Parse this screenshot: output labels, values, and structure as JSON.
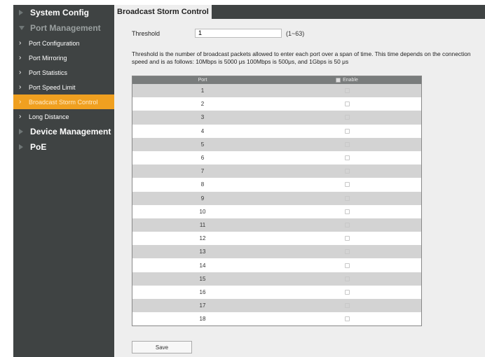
{
  "sidebar": {
    "system_config": "System Config",
    "port_management": "Port Management",
    "items": [
      {
        "label": "Port Configuration"
      },
      {
        "label": "Port Mirroring"
      },
      {
        "label": "Port Statistics"
      },
      {
        "label": "Port Speed Limit"
      },
      {
        "label": "Broadcast Storm Control"
      },
      {
        "label": "Long Distance"
      }
    ],
    "device_management": "Device Management",
    "poe": "PoE"
  },
  "tab": {
    "title": "Broadcast Storm Control"
  },
  "threshold": {
    "label": "Threshold",
    "value": "1",
    "range": "(1~63)"
  },
  "description": "Threshold is the number of broadcast packets allowed to enter each port over a span of time. This time depends on the connection speed and is as follows: 10Mbps is 5000 μs   100Mbps is 500μs, and 1Gbps is 50 μs",
  "table": {
    "header_port": "Port",
    "header_enable": "Enable",
    "rows": [
      "1",
      "2",
      "3",
      "4",
      "5",
      "6",
      "7",
      "8",
      "9",
      "10",
      "11",
      "12",
      "13",
      "14",
      "15",
      "16",
      "17",
      "18"
    ]
  },
  "save_label": "Save",
  "colors": {
    "sidebar": "#3f4343",
    "active": "#f0a020",
    "content": "#eeeeee",
    "alt_row": "#d3d3d3"
  }
}
